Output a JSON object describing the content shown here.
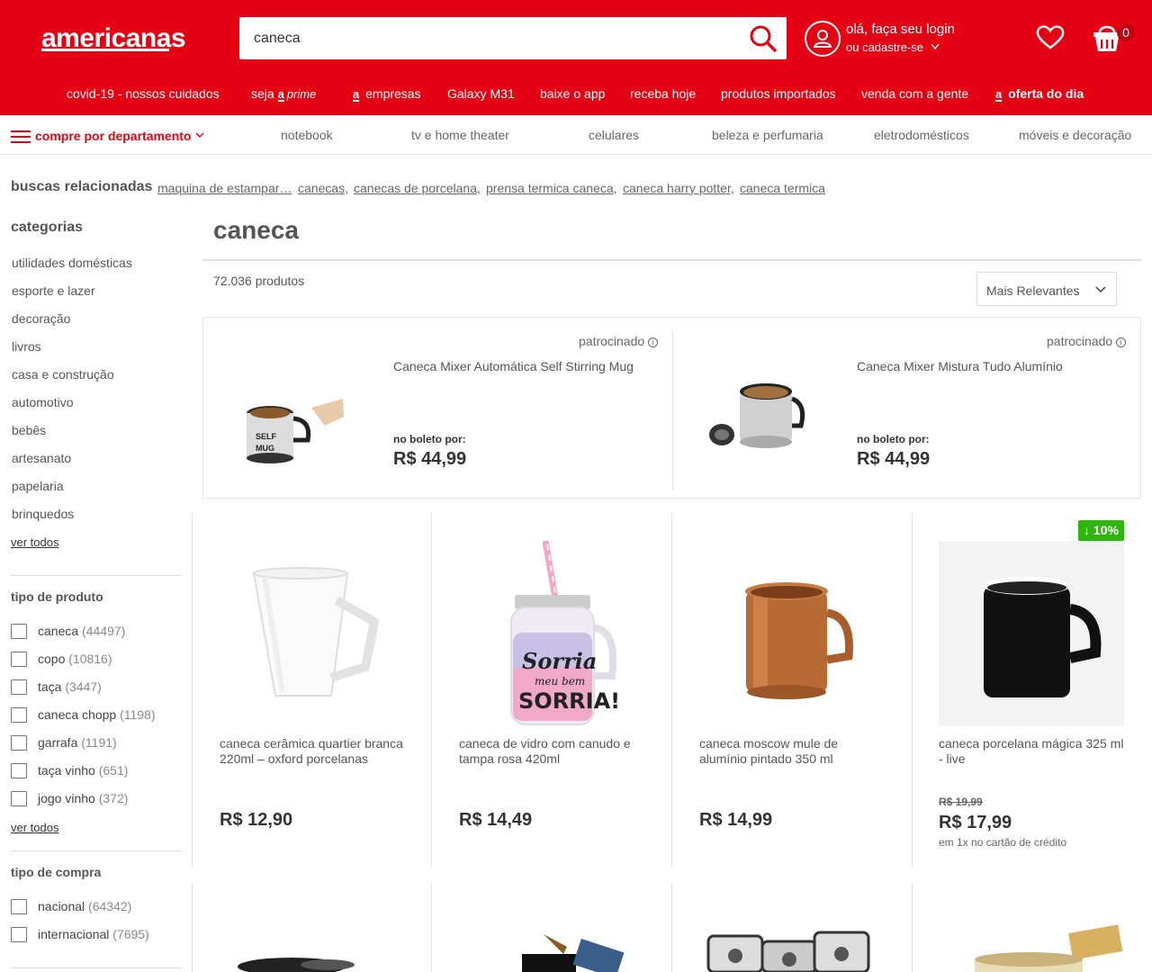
{
  "header": {
    "logo": "americanas",
    "search_value": "caneca",
    "login_line1": "olá, faça seu login",
    "login_line2": "ou cadastre-se",
    "cart_count": "0",
    "brand_color": "#e60014"
  },
  "topnav": {
    "items": [
      "covid-19 - nossos cuidados",
      "seja",
      "prime",
      "empresas",
      "Galaxy M31",
      "baixe o app",
      "receba hoje",
      "produtos importados",
      "venda com a gente",
      "oferta do dia"
    ]
  },
  "deptbar": {
    "label": "compre por departamento",
    "items": [
      "notebook",
      "tv e home theater",
      "celulares",
      "beleza e perfumaria",
      "eletrodomésticos",
      "móveis e decoração"
    ]
  },
  "related": {
    "title": "buscas relacionadas",
    "items": [
      "maquina de estampar…",
      "canecas,",
      "canecas de porcelana,",
      "prensa termica caneca,",
      "caneca harry potter,",
      "caneca termica"
    ]
  },
  "sidebar": {
    "categories_title": "categorias",
    "categories": [
      "utilidades domésticas",
      "esporte e lazer",
      "decoração",
      "livros",
      "casa e construção",
      "automotivo",
      "bebês",
      "artesanato",
      "papelaria",
      "brinquedos"
    ],
    "ver_todos": "ver todos",
    "tipo_produto_title": "tipo de produto",
    "tipo_produto": [
      {
        "label": "caneca",
        "count": "(44497)"
      },
      {
        "label": "copo",
        "count": "(10816)"
      },
      {
        "label": "taça",
        "count": "(3447)"
      },
      {
        "label": "caneca chopp",
        "count": "(1198)"
      },
      {
        "label": "garrafa",
        "count": "(1191)"
      },
      {
        "label": "taça vinho",
        "count": "(651)"
      },
      {
        "label": "jogo vinho",
        "count": "(372)"
      }
    ],
    "tipo_compra_title": "tipo de compra",
    "tipo_compra": [
      {
        "label": "nacional",
        "count": "(64342)"
      },
      {
        "label": "internacional",
        "count": "(7695)"
      }
    ]
  },
  "main": {
    "title": "caneca",
    "count": "72.036 produtos",
    "sort": "Mais Relevantes"
  },
  "sponsored": [
    {
      "tag": "patrocinado",
      "name": "Caneca Mixer Automática Self Stirring Mug",
      "price_label": "no boleto por:",
      "price": "R$ 44,99"
    },
    {
      "tag": "patrocinado",
      "name": "Caneca Mixer Mistura Tudo Alumínio",
      "price_label": "no boleto por:",
      "price": "R$ 44,99"
    }
  ],
  "products": [
    {
      "name": "caneca cerâmica quartier branca 220ml – oxford porcelanas",
      "price": "R$ 12,90"
    },
    {
      "name": "caneca de vidro com canudo e tampa rosa 420ml",
      "price": "R$ 14,49",
      "mug_text_1": "Sorria",
      "mug_text_2": "meu bem",
      "mug_text_3": "SORRIA!"
    },
    {
      "name": "caneca moscow mule de alumínio pintado 350 ml",
      "price": "R$ 14,99"
    },
    {
      "name": "caneca porcelana mágica 325 ml - live",
      "old_price": "R$ 19,99",
      "price": "R$ 17,99",
      "installment": "em 1x no cartão de crédito",
      "discount": "10%"
    }
  ],
  "colors": {
    "accent": "#e60014",
    "discount": "#2fb50d"
  }
}
